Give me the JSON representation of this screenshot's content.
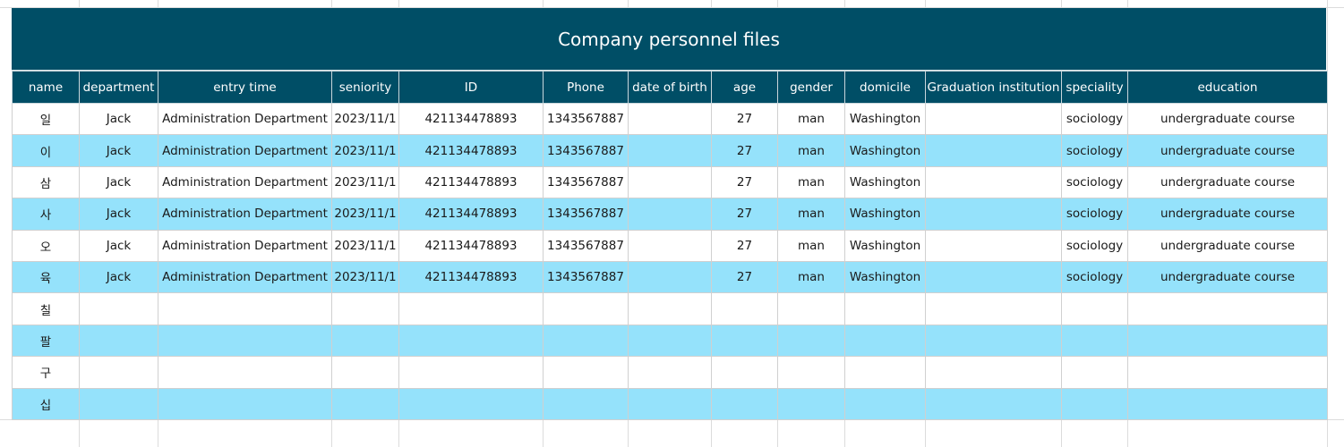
{
  "title": "Company personnel files",
  "headers": [
    "name",
    "department",
    "entry time",
    "seniority",
    "ID",
    "Phone",
    "date of birth",
    "age",
    "gender",
    "domicile",
    "Graduation institution",
    "speciality",
    "education"
  ],
  "rows": [
    [
      "일",
      "Jack",
      "Administration Department",
      "2023/11/1",
      "421134478893",
      "1343567887",
      "",
      "27",
      "man",
      "Washington",
      "",
      "sociology",
      "undergraduate course"
    ],
    [
      "이",
      "Jack",
      "Administration Department",
      "2023/11/1",
      "421134478893",
      "1343567887",
      "",
      "27",
      "man",
      "Washington",
      "",
      "sociology",
      "undergraduate course"
    ],
    [
      "삼",
      "Jack",
      "Administration Department",
      "2023/11/1",
      "421134478893",
      "1343567887",
      "",
      "27",
      "man",
      "Washington",
      "",
      "sociology",
      "undergraduate course"
    ],
    [
      "사",
      "Jack",
      "Administration Department",
      "2023/11/1",
      "421134478893",
      "1343567887",
      "",
      "27",
      "man",
      "Washington",
      "",
      "sociology",
      "undergraduate course"
    ],
    [
      "오",
      "Jack",
      "Administration Department",
      "2023/11/1",
      "421134478893",
      "1343567887",
      "",
      "27",
      "man",
      "Washington",
      "",
      "sociology",
      "undergraduate course"
    ],
    [
      "육",
      "Jack",
      "Administration Department",
      "2023/11/1",
      "421134478893",
      "1343567887",
      "",
      "27",
      "man",
      "Washington",
      "",
      "sociology",
      "undergraduate course"
    ],
    [
      "칠",
      "",
      "",
      "",
      "",
      "",
      "",
      "",
      "",
      "",
      "",
      "",
      ""
    ],
    [
      "팔",
      "",
      "",
      "",
      "",
      "",
      "",
      "",
      "",
      "",
      "",
      "",
      ""
    ],
    [
      "구",
      "",
      "",
      "",
      "",
      "",
      "",
      "",
      "",
      "",
      "",
      "",
      ""
    ],
    [
      "십",
      "",
      "",
      "",
      "",
      "",
      "",
      "",
      "",
      "",
      "",
      "",
      ""
    ]
  ],
  "colors": {
    "header_bg": "#004e66",
    "header_text": "#ffffff",
    "band_row": "#95e2fb",
    "plain_row": "#ffffff"
  }
}
